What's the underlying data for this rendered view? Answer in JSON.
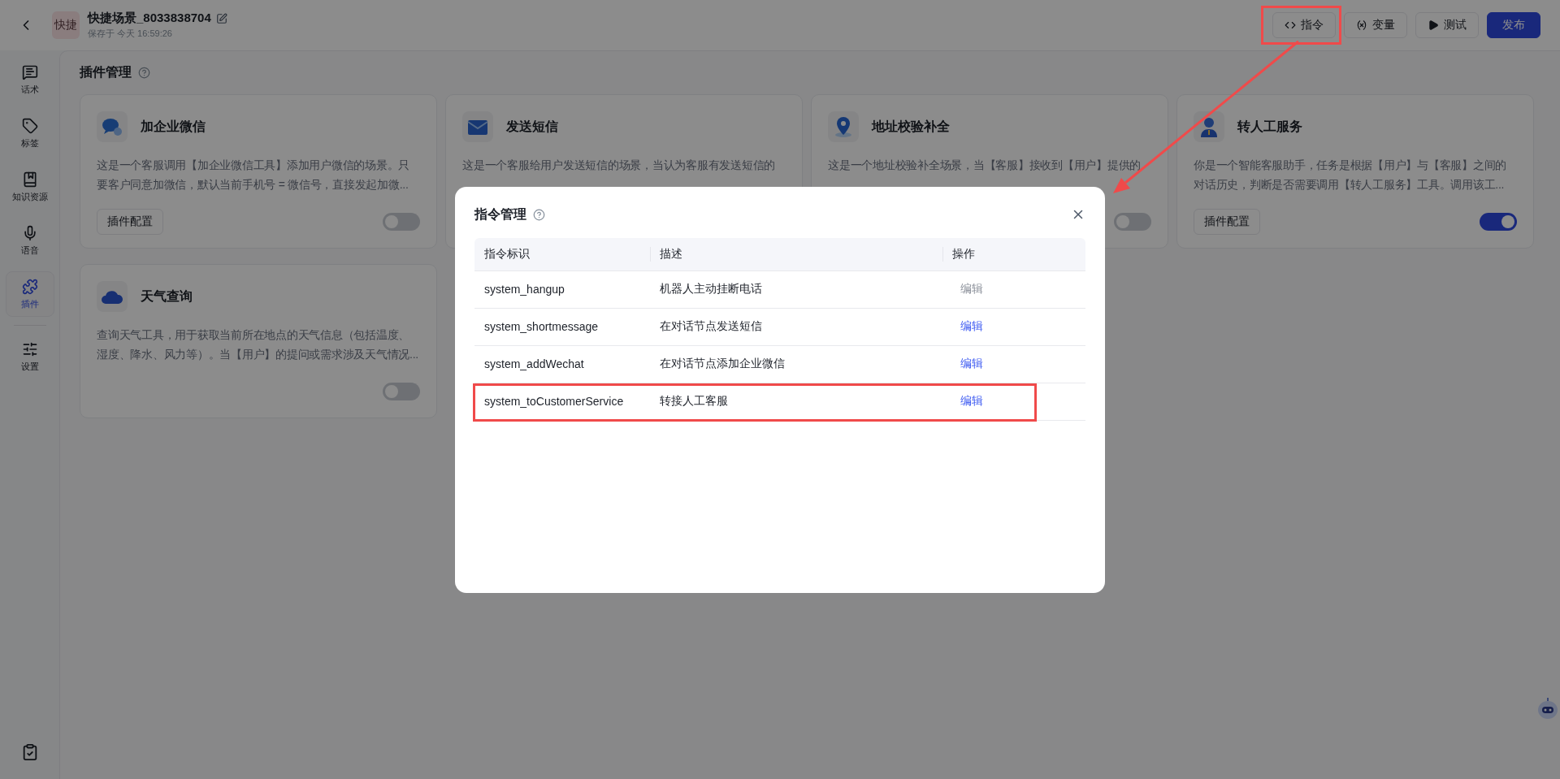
{
  "header": {
    "logo": "快捷",
    "title": "快捷场景_8033838704",
    "saved": "保存于 今天 16:59:26",
    "buttons": [
      {
        "label": "指令",
        "kind": "code",
        "highlighted": true
      },
      {
        "label": "变量",
        "kind": "variable",
        "highlighted": false
      },
      {
        "label": "测试",
        "kind": "play",
        "highlighted": false
      },
      {
        "label": "发布",
        "kind": "primary",
        "highlighted": false
      }
    ]
  },
  "sidebar": {
    "items": [
      {
        "label": "话术",
        "selected": false
      },
      {
        "label": "标签",
        "selected": false
      },
      {
        "label": "知识资源",
        "selected": false
      },
      {
        "label": "语音",
        "selected": false
      },
      {
        "label": "插件",
        "selected": true
      },
      {
        "label": "设置",
        "selected": false
      }
    ]
  },
  "page": {
    "title": "插件管理"
  },
  "plugins": [
    {
      "kind": "wechat",
      "name": "加企业微信",
      "description": "这是一个客服调用【加企业微信工具】添加用户微信的场景。只要客户同意加微信，默认当前手机号 = 微信号，直接发起加微...",
      "config_button": "插件配置",
      "on": false
    },
    {
      "kind": "sms",
      "name": "发送短信",
      "description": "这是一个客服给用户发送短信的场景，当认为客服有发送短信的"
    },
    {
      "kind": "address",
      "name": "地址校验补全",
      "description": "这是一个地址校验补全场景，当【客服】接收到【用户】提供的",
      "on": false
    },
    {
      "kind": "agent",
      "name": "转人工服务",
      "description": "你是一个智能客服助手，任务是根据【用户】与【客服】之间的对话历史，判断是否需要调用【转人工服务】工具。调用该工...",
      "config_button": "插件配置",
      "on": true
    },
    {
      "kind": "weather",
      "name": "天气查询",
      "description": "查询天气工具，用于获取当前所在地点的天气信息（包括温度、湿度、降水、风力等）。当【用户】的提问或需求涉及天气情况...",
      "on": false
    }
  ],
  "modal": {
    "title": "指令管理",
    "columns": [
      "指令标识",
      "描述",
      "操作"
    ],
    "rows": [
      {
        "id": "system_hangup",
        "description": "机器人主动挂断电话",
        "action": "编辑",
        "disabled": true,
        "highlighted": false
      },
      {
        "id": "system_shortmessage",
        "description": "在对话节点发送短信",
        "action": "编辑",
        "disabled": false,
        "highlighted": false
      },
      {
        "id": "system_addWechat",
        "description": "在对话节点添加企业微信",
        "action": "编辑",
        "disabled": false,
        "highlighted": false
      },
      {
        "id": "system_toCustomerService",
        "description": "转接人工客服",
        "action": "编辑",
        "disabled": false,
        "highlighted": true
      }
    ]
  }
}
